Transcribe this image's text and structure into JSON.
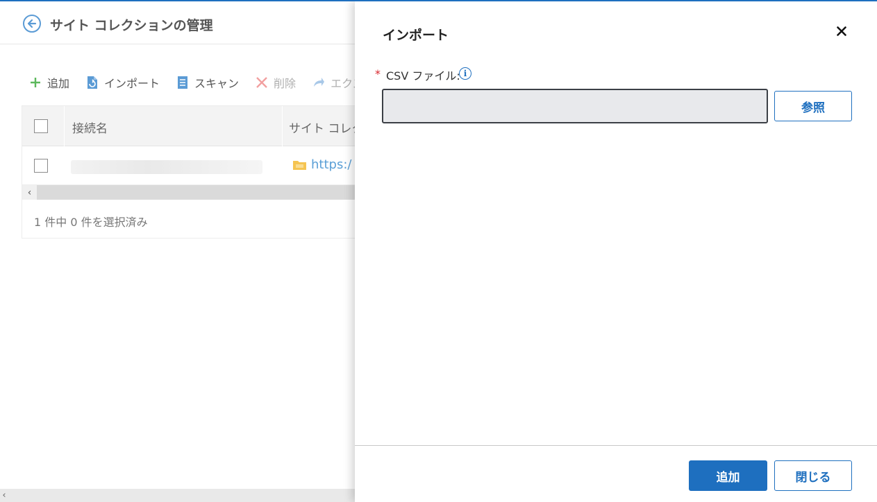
{
  "background": {
    "page_title": "サイト コレクションの管理",
    "toolbar": {
      "add": "追加",
      "import": "インポート",
      "scan": "スキャン",
      "delete": "削除",
      "export": "エクス"
    },
    "table": {
      "columns": [
        "接続名",
        "サイト コレクシ"
      ],
      "rows": [
        {
          "link": "https:/"
        }
      ],
      "selection_summary": "1 件中 0 件を選択済み"
    }
  },
  "panel": {
    "title": "インポート",
    "required_marker": "*",
    "csv_label": "CSV ファイル:",
    "info_icon_glyph": "i",
    "file_value": "",
    "browse_label": "参照",
    "add_label": "追加",
    "close_label": "閉じる"
  },
  "colors": {
    "accent": "#1e6fbf",
    "required": "#d9272e",
    "link": "#5a9fd6"
  }
}
